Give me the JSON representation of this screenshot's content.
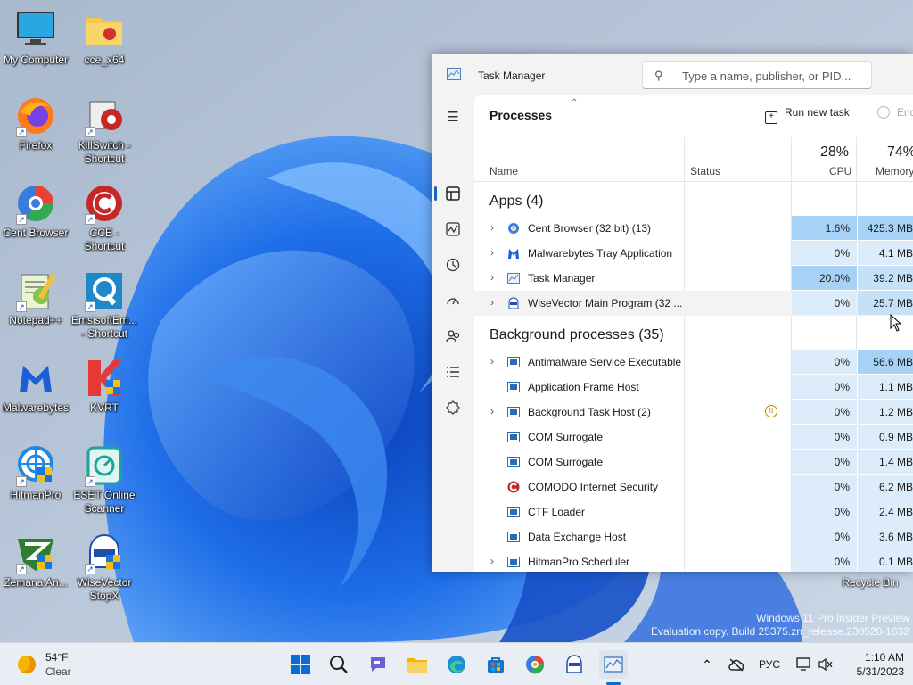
{
  "desktop": {
    "icons": [
      {
        "label": "My Computer"
      },
      {
        "label": "cce_x64"
      },
      {
        "label": "Firefox"
      },
      {
        "label": "KillSwitch - Shortcut"
      },
      {
        "label": "Cent Browser"
      },
      {
        "label": "CCE - Shortcut"
      },
      {
        "label": "Notepad++"
      },
      {
        "label": "EmsisoftEm... - Shortcut"
      },
      {
        "label": "Malwarebytes"
      },
      {
        "label": "KVRT"
      },
      {
        "label": "HitmanPro"
      },
      {
        "label": "ESET Online Scanner"
      },
      {
        "label": "Zemana An..."
      },
      {
        "label": "WiseVector StopX"
      }
    ],
    "recycle_bin": "Recycle Bin",
    "watermark_line1": "Windows 11 Pro Insider Preview",
    "watermark_line2": "Evaluation copy. Build 25375.zn_release.230520-1632"
  },
  "task_manager": {
    "title": "Task Manager",
    "search_placeholder": "Type a name, publisher, or PID...",
    "page_title": "Processes",
    "run_new_task": "Run new task",
    "end_task": "End task",
    "columns": {
      "name": "Name",
      "status": "Status",
      "cpu_label": "CPU",
      "cpu_total": "28%",
      "memory_label": "Memory",
      "memory_total": "74%"
    },
    "groups": {
      "apps": "Apps (4)",
      "background": "Background processes (35)"
    },
    "apps": [
      {
        "name": "Cent Browser (32 bit) (13)",
        "cpu": "1.6%",
        "memory": "425.3 MB"
      },
      {
        "name": "Malwarebytes Tray Application",
        "cpu": "0%",
        "memory": "4.1 MB"
      },
      {
        "name": "Task Manager",
        "cpu": "20.0%",
        "memory": "39.2 MB"
      },
      {
        "name": "WiseVector Main Program (32 ...",
        "cpu": "0%",
        "memory": "25.7 MB"
      }
    ],
    "background": [
      {
        "name": "Antimalware Service Executable",
        "cpu": "0%",
        "memory": "56.6 MB"
      },
      {
        "name": "Application Frame Host",
        "cpu": "0%",
        "memory": "1.1 MB"
      },
      {
        "name": "Background Task Host (2)",
        "cpu": "0%",
        "memory": "1.2 MB"
      },
      {
        "name": "COM Surrogate",
        "cpu": "0%",
        "memory": "0.9 MB"
      },
      {
        "name": "COM Surrogate",
        "cpu": "0%",
        "memory": "1.4 MB"
      },
      {
        "name": "COMODO Internet Security",
        "cpu": "0%",
        "memory": "6.2 MB"
      },
      {
        "name": "CTF Loader",
        "cpu": "0%",
        "memory": "2.4 MB"
      },
      {
        "name": "Data Exchange Host",
        "cpu": "0%",
        "memory": "3.6 MB"
      },
      {
        "name": "HitmanPro Scheduler",
        "cpu": "0%",
        "memory": "0.1 MB"
      }
    ]
  },
  "taskbar": {
    "weather_temp": "54°F",
    "weather_desc": "Clear",
    "language": "РУС",
    "time": "1:10 AM",
    "date": "5/31/2023"
  }
}
